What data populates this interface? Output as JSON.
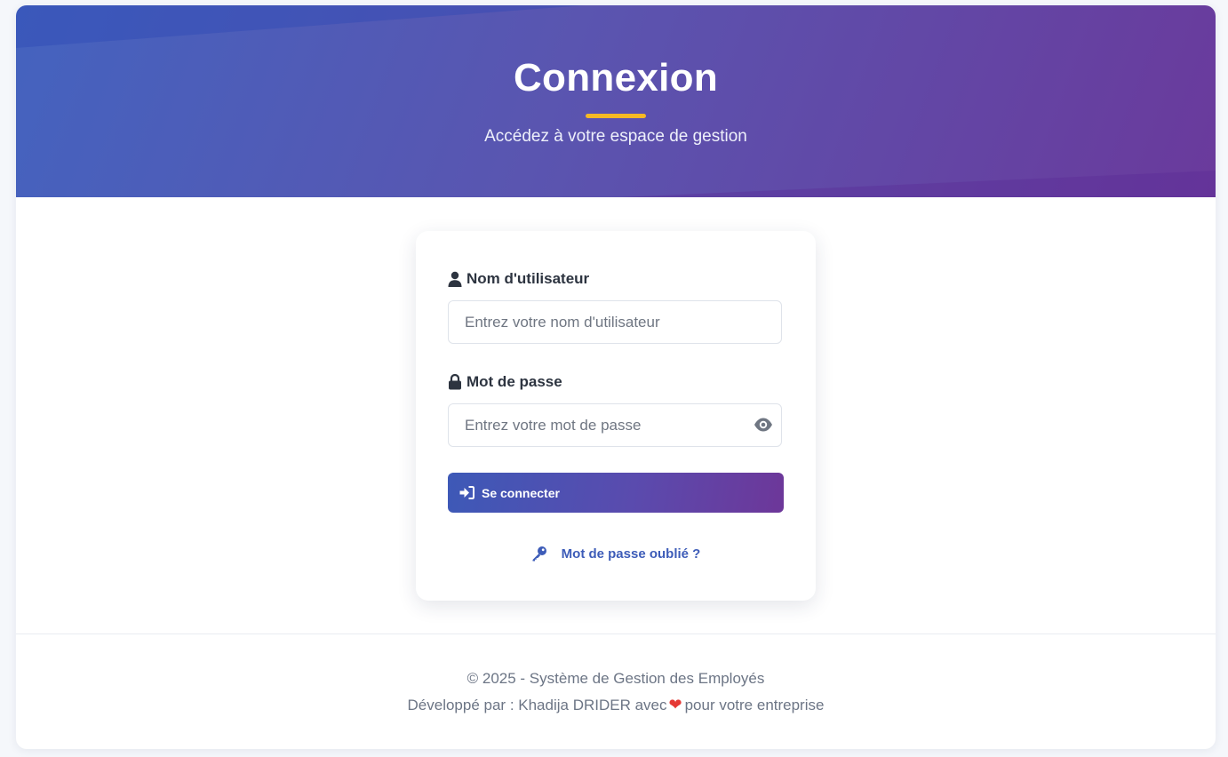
{
  "header": {
    "title": "Connexion",
    "subtitle": "Accédez à votre espace de gestion"
  },
  "form": {
    "username": {
      "label": "Nom d'utilisateur",
      "placeholder": "Entrez votre nom d'utilisateur",
      "value": "",
      "icon": "user-icon"
    },
    "password": {
      "label": "Mot de passe",
      "placeholder": "Entrez votre mot de passe",
      "value": "",
      "icon": "lock-icon",
      "toggle_icon": "eye-icon"
    },
    "submit": {
      "label": "Se connecter",
      "icon": "sign-in-icon"
    },
    "forgot": {
      "label": "Mot de passe oublié ?",
      "icon": "key-icon"
    }
  },
  "footer": {
    "copyright": "© 2025 - Système de Gestion des Employés",
    "credit_prefix": "Développé par : Khadija DRIDER avec",
    "heart": "❤",
    "credit_suffix": "pour votre entreprise"
  },
  "colors": {
    "accent_gradient_start": "#4463bf",
    "accent_gradient_end": "#6a3a9c",
    "underline": "#f7b924",
    "link": "#3d5cb8",
    "heart": "#e53935"
  }
}
